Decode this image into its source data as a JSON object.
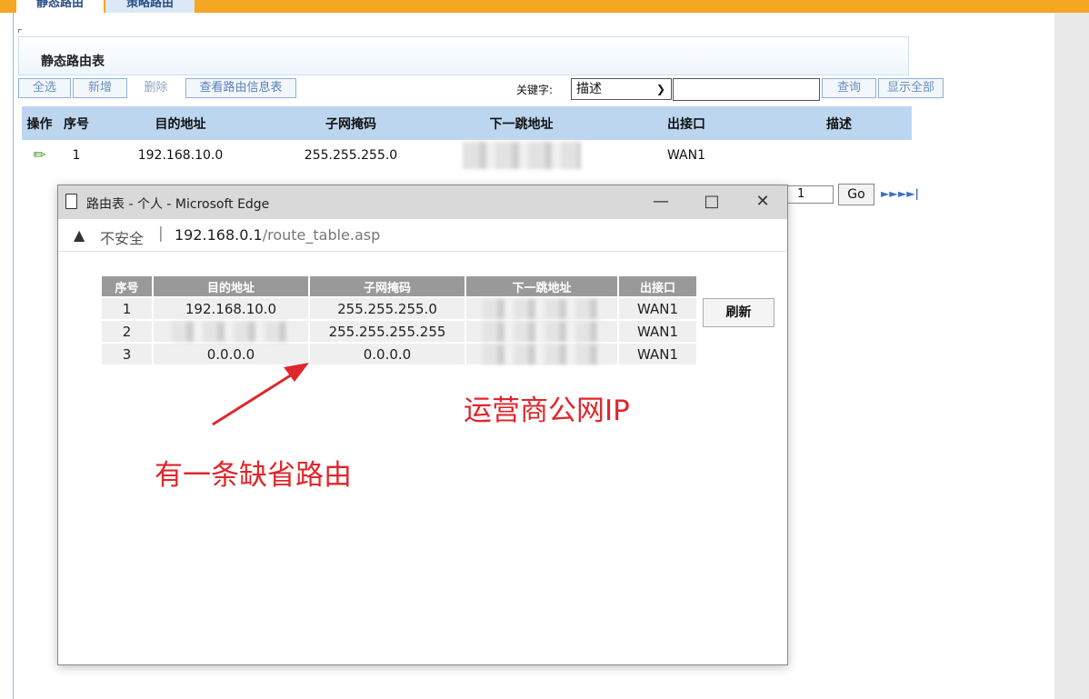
{
  "tabs": [
    {
      "label": "静态路由"
    },
    {
      "label": "策略路由"
    }
  ],
  "panel": {
    "title": "静态路由表"
  },
  "toolbar": {
    "select_all": "全选",
    "add": "新增",
    "delete": "删除",
    "view_route_info": "查看路由信息表",
    "keyword_label": "关键字:",
    "keyword_select_value": "描述",
    "query": "查询",
    "show_all": "显示全部"
  },
  "route_table": {
    "headers": [
      "操作",
      "序号",
      "目的地址",
      "子网掩码",
      "下一跳地址",
      "出接口",
      "描述"
    ],
    "rows": [
      {
        "index": "1",
        "dest": "192.168.10.0",
        "mask": "255.255.255.0",
        "next_hop": "",
        "iface": "WAN1",
        "desc": ""
      }
    ]
  },
  "pagination": {
    "page": "1",
    "go": "Go"
  },
  "popup": {
    "title": "路由表 - 个人 - Microsoft Edge",
    "not_secure": "不安全",
    "url_host": "192.168.0.1",
    "url_path": "/route_table.asp",
    "table": {
      "headers": [
        "序号",
        "目的地址",
        "子网掩码",
        "下一跳地址",
        "出接口"
      ],
      "rows": [
        {
          "index": "1",
          "dest": "192.168.10.0",
          "mask": "255.255.255.0",
          "iface": "WAN1"
        },
        {
          "index": "2",
          "dest": "",
          "mask": "255.255.255.255",
          "iface": "WAN1"
        },
        {
          "index": "3",
          "dest": "0.0.0.0",
          "mask": "0.0.0.0",
          "iface": "WAN1"
        }
      ]
    },
    "refresh": "刷新"
  },
  "annotations": {
    "isp_ip": "运营商公网IP",
    "default_route": "有一条缺省路由",
    "color": "#e0262b"
  },
  "colors": {
    "top_bar": "#f5a623",
    "table_header": "#bcd6f0",
    "popup_header": "#999999"
  }
}
